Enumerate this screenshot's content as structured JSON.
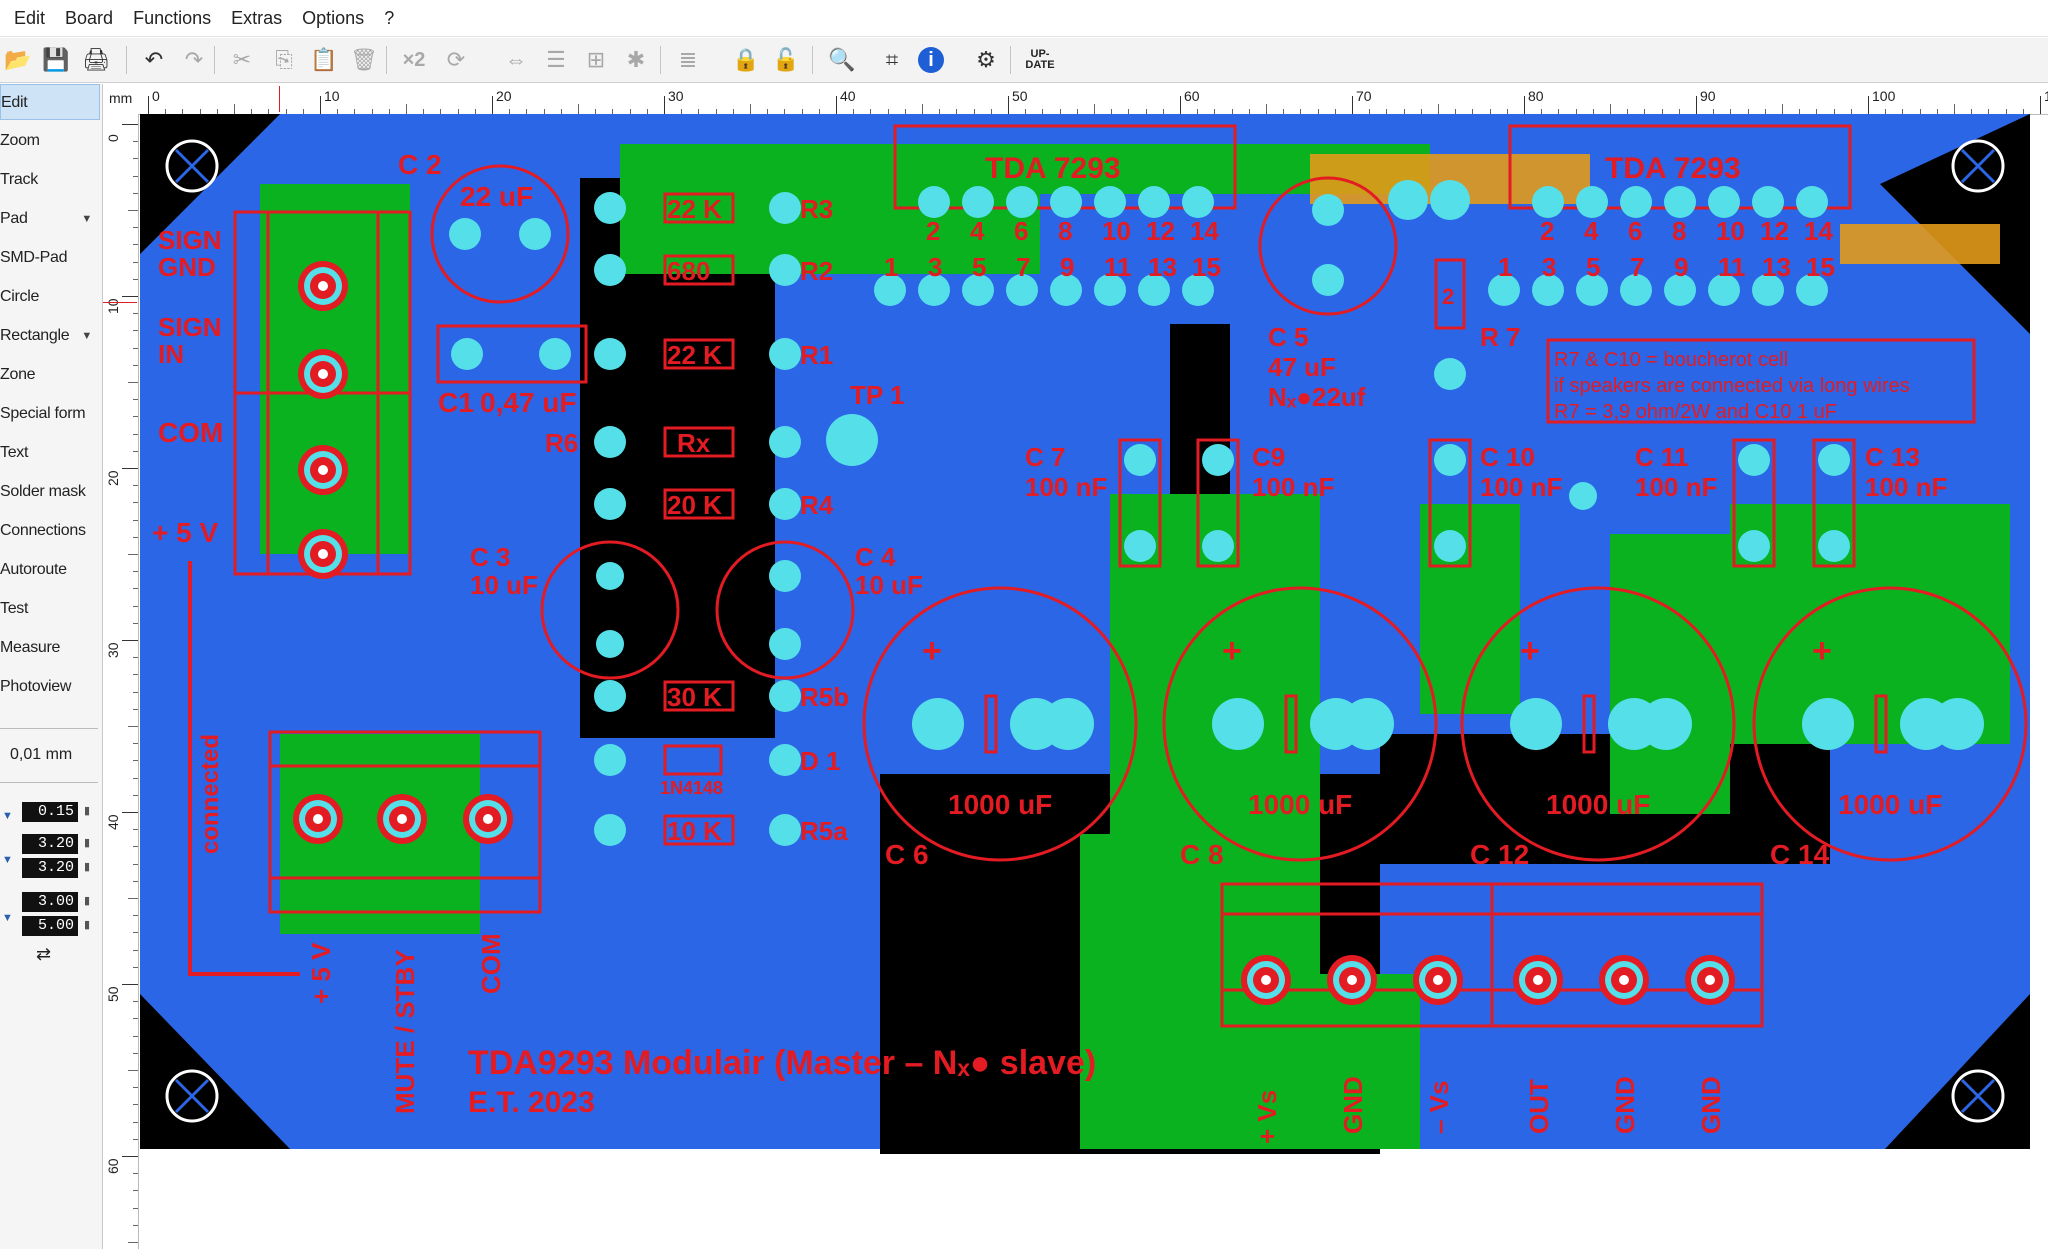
{
  "menu": [
    "Edit",
    "Board",
    "Functions",
    "Extras",
    "Options",
    "?"
  ],
  "toolbar": {
    "icons": [
      "open-folder-icon",
      "save-icon",
      "print-icon",
      "undo-icon",
      "redo-icon",
      "cut-icon",
      "copy-icon",
      "paste-icon",
      "delete-icon",
      "x2-icon",
      "rotate-icon",
      "mirror-icon",
      "align-icon",
      "group-icon",
      "snap-icon",
      "layers-icon",
      "lock-icon",
      "unlock-icon",
      "zoom-search-icon",
      "crop-icon",
      "info-icon",
      "gear-icon",
      "update-icon"
    ],
    "x2_label": "×2",
    "update_label": [
      "UP-",
      "DATE"
    ]
  },
  "sidebar": {
    "items": [
      {
        "label": "Edit",
        "active": true,
        "dropdown": false
      },
      {
        "label": "Zoom",
        "dropdown": false
      },
      {
        "label": "Track",
        "dropdown": false
      },
      {
        "label": "Pad",
        "dropdown": true
      },
      {
        "label": "SMD-Pad",
        "dropdown": false
      },
      {
        "label": "Circle",
        "dropdown": false
      },
      {
        "label": "Rectangle",
        "dropdown": true
      },
      {
        "label": "Zone",
        "dropdown": false
      },
      {
        "label": "Special form",
        "dropdown": false
      },
      {
        "label": "Text",
        "dropdown": false
      },
      {
        "label": "Solder mask",
        "dropdown": false
      },
      {
        "label": "Connections",
        "dropdown": false
      },
      {
        "label": "Autoroute",
        "dropdown": false
      },
      {
        "label": "Test",
        "dropdown": false
      },
      {
        "label": "Measure",
        "dropdown": false
      },
      {
        "label": "Photoview",
        "dropdown": false
      }
    ],
    "grid": "0,01 mm",
    "values": [
      "0.15",
      "3.20",
      "3.20",
      "3.00",
      "5.00"
    ]
  },
  "ruler": {
    "unit": "mm",
    "h_labels": [
      "0",
      "10",
      "20",
      "30",
      "40",
      "50",
      "60",
      "70",
      "80",
      "90",
      "100",
      "1"
    ],
    "v_labels": [
      "0",
      "10",
      "20",
      "30",
      "40",
      "50",
      "60"
    ]
  },
  "board": {
    "colors": {
      "copper_top": "#2b66e6",
      "copper_bottom": "#0bb21f",
      "silk": "#e31b23",
      "pad": "#55dfe8",
      "bg": "#000000"
    },
    "pad_icon": "red-center-pad-icon",
    "labels": {
      "ic1": "TDA 7293",
      "ic2": "TDA 7293",
      "c2": "C 2",
      "c2v": "22 uF",
      "c1": "C1",
      "c1v": "0,47 uF",
      "r3v": "22 K",
      "r3": "R3",
      "r2v": "680",
      "r2": "R2",
      "r1v": "22 K",
      "r1": "R1",
      "r6": "R6",
      "r6v": "Rx",
      "r4v": "20 K",
      "r4": "R4",
      "tp1": "TP 1",
      "c3": "C 3",
      "c3v": "10 uF",
      "c4": "C 4",
      "c4v": "10 uF",
      "r5bv": "30 K",
      "r5b": "R5b",
      "d1v": "1N4148",
      "d1": "D 1",
      "r5av": "10 K",
      "r5a": "R5a",
      "sign_gnd": "SIGN\nGND",
      "sign_in": "SIGN\nIN",
      "com_left": "COM",
      "plus5v_left": "+ 5 V",
      "connected": "connected",
      "plus5v": "+ 5 V",
      "mute": "MUTE / STBY",
      "com_bottom": "COM",
      "title": "TDA9293 Modulair (Master – Nₓ● slave)",
      "author": "E.T. 2023",
      "c5": "C 5",
      "c5v": "47 uF",
      "c5n": "Nₓ●22uf",
      "r7": "R 7",
      "r7b": "2",
      "note1": "R7 & C10 = boucherot cell",
      "note2": "if speakers are connected via long wires",
      "note3": "R7 = 3,9 ohm/2W and C10 1 uF",
      "c7": "C 7",
      "c7v": "100 nF",
      "c9": "C9",
      "c9v": "100 nF",
      "c10": "C 10",
      "c10v": "100 nF",
      "c11": "C 11",
      "c11v": "100 nF",
      "c13": "C 13",
      "c13v": "100 nF",
      "cap1000": "1000 uF",
      "c6": "C 6",
      "c8": "C 8",
      "c12": "C 12",
      "c14": "C 14",
      "pvs": "+ Vs",
      "gnd": "GND",
      "mvs": "– Vs",
      "out": "OUT",
      "pins_top": [
        "2",
        "4",
        "6",
        "8",
        "10",
        "12",
        "14"
      ],
      "pins_bottom": [
        "1",
        "3",
        "5",
        "7",
        "9",
        "11",
        "13",
        "15"
      ],
      "plus": "+"
    }
  }
}
